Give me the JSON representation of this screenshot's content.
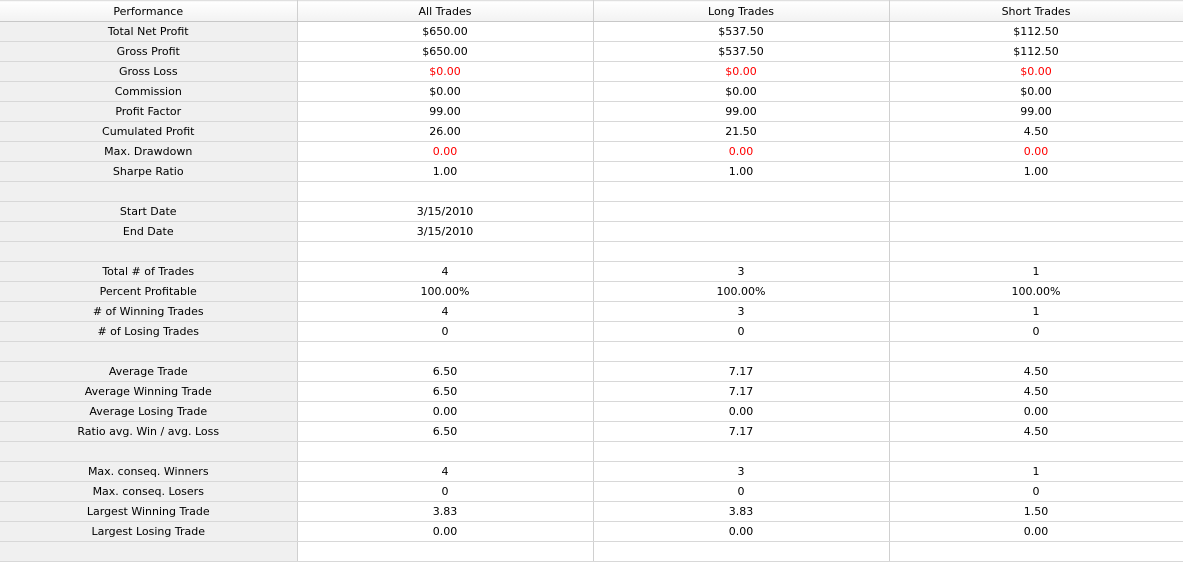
{
  "header": [
    "Performance",
    "All Trades",
    "Long Trades",
    "Short Trades"
  ],
  "rows": [
    {
      "label": "Total Net Profit",
      "values": [
        "$650.00",
        "$537.50",
        "$112.50"
      ],
      "red": false
    },
    {
      "label": "Gross Profit",
      "values": [
        "$650.00",
        "$537.50",
        "$112.50"
      ],
      "red": false
    },
    {
      "label": "Gross Loss",
      "values": [
        "$0.00",
        "$0.00",
        "$0.00"
      ],
      "red": true
    },
    {
      "label": "Commission",
      "values": [
        "$0.00",
        "$0.00",
        "$0.00"
      ],
      "red": false
    },
    {
      "label": "Profit Factor",
      "values": [
        "99.00",
        "99.00",
        "99.00"
      ],
      "red": false
    },
    {
      "label": "Cumulated Profit",
      "values": [
        "26.00",
        "21.50",
        "4.50"
      ],
      "red": false
    },
    {
      "label": "Max. Drawdown",
      "values": [
        "0.00",
        "0.00",
        "0.00"
      ],
      "red": true
    },
    {
      "label": "Sharpe Ratio",
      "values": [
        "1.00",
        "1.00",
        "1.00"
      ],
      "red": false
    },
    {
      "label": "",
      "values": [
        "",
        "",
        ""
      ],
      "red": false
    },
    {
      "label": "Start Date",
      "values": [
        "3/15/2010",
        "",
        ""
      ],
      "red": false
    },
    {
      "label": "End Date",
      "values": [
        "3/15/2010",
        "",
        ""
      ],
      "red": false
    },
    {
      "label": "",
      "values": [
        "",
        "",
        ""
      ],
      "red": false
    },
    {
      "label": "Total # of Trades",
      "values": [
        "4",
        "3",
        "1"
      ],
      "red": false
    },
    {
      "label": "Percent Profitable",
      "values": [
        "100.00%",
        "100.00%",
        "100.00%"
      ],
      "red": false
    },
    {
      "label": "# of Winning Trades",
      "values": [
        "4",
        "3",
        "1"
      ],
      "red": false
    },
    {
      "label": "# of Losing Trades",
      "values": [
        "0",
        "0",
        "0"
      ],
      "red": false
    },
    {
      "label": "",
      "values": [
        "",
        "",
        ""
      ],
      "red": false
    },
    {
      "label": "Average Trade",
      "values": [
        "6.50",
        "7.17",
        "4.50"
      ],
      "red": false
    },
    {
      "label": "Average Winning Trade",
      "values": [
        "6.50",
        "7.17",
        "4.50"
      ],
      "red": false
    },
    {
      "label": "Average Losing Trade",
      "values": [
        "0.00",
        "0.00",
        "0.00"
      ],
      "red": false
    },
    {
      "label": "Ratio avg. Win / avg. Loss",
      "values": [
        "6.50",
        "7.17",
        "4.50"
      ],
      "red": false
    },
    {
      "label": "",
      "values": [
        "",
        "",
        ""
      ],
      "red": false
    },
    {
      "label": "Max. conseq. Winners",
      "values": [
        "4",
        "3",
        "1"
      ],
      "red": false
    },
    {
      "label": "Max. conseq. Losers",
      "values": [
        "0",
        "0",
        "0"
      ],
      "red": false
    },
    {
      "label": "Largest Winning Trade",
      "values": [
        "3.83",
        "3.83",
        "1.50"
      ],
      "red": false
    },
    {
      "label": "Largest Losing Trade",
      "values": [
        "0.00",
        "0.00",
        "0.00"
      ],
      "red": false
    },
    {
      "label": "",
      "values": [
        "",
        "",
        ""
      ],
      "red": false
    }
  ],
  "colors": {
    "loss_red": "#ff0000",
    "label_bg": "#f0f0f0"
  }
}
